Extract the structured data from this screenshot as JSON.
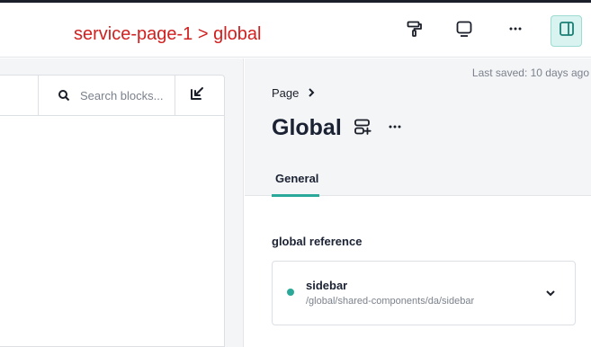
{
  "topbar": {
    "breadcrumb_title": "service-page-1 > global",
    "icons": [
      "paint-roller-icon",
      "monitor-icon",
      "more-horizontal-icon",
      "panel-right-icon"
    ],
    "accent_color": "#d0201f"
  },
  "block_panel": {
    "search_placeholder": "Search blocks...",
    "icons": [
      "search-icon",
      "collapse-arrow-icon"
    ]
  },
  "right_panel": {
    "last_saved": "Last saved: 10 days ago",
    "breadcrumb_label": "Page",
    "title": "Global",
    "tabs": [
      {
        "label": "General",
        "active": true
      }
    ],
    "field_label": "global reference",
    "reference": {
      "name": "sidebar",
      "path": "/global/shared-components/da/sidebar",
      "status_color": "#2aa899"
    }
  }
}
